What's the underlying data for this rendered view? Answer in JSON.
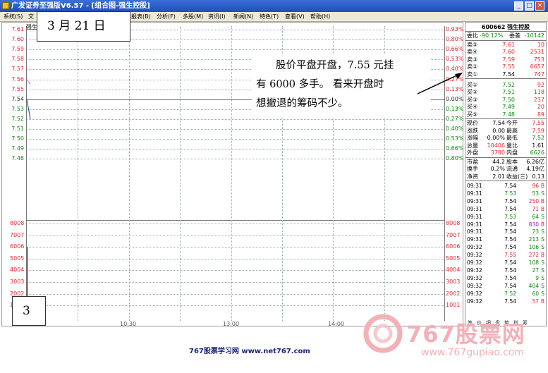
{
  "window": {
    "title": "广发证券至强版V6.57 - [组合图-强生控股]",
    "buttons": [
      "_",
      "□",
      "×"
    ]
  },
  "menu": [
    "系统(S)",
    "文",
    "报表(B)",
    "分析(F)",
    "多股(M)",
    "资讯(I)",
    "新闻(N)",
    "特色(T)",
    "查看(V)",
    "帮助(H)"
  ],
  "chart": {
    "stock_label": "强生",
    "date_label": "3 月 21 日",
    "figure_number": "3",
    "price_ticks_left": [
      "7.61",
      "7.60",
      "7.59",
      "7.58",
      "7.57",
      "7.56",
      "7.55",
      "7.54",
      "7.53",
      "7.52",
      "7.51",
      "7.50",
      "7.49",
      "7.48"
    ],
    "pct_ticks_right": [
      "0.93%",
      "0.80%",
      "0.66%",
      "0.53%",
      "0.40%",
      "0.27%",
      "0.13%",
      "0.00%",
      "0.13%",
      "0.27%",
      "0.40%",
      "0.53%",
      "0.66%",
      "0.80%"
    ],
    "volume_ticks": [
      "8008",
      "7007",
      "6006",
      "5005",
      "4004",
      "3003",
      "2002",
      "1001"
    ],
    "time_ticks": [
      "10:30",
      "13:00",
      "14:00"
    ]
  },
  "chart_data": {
    "type": "line",
    "xlabel": "",
    "ylabel": "",
    "price_range": [
      7.48,
      7.61
    ],
    "prev_close": 7.54,
    "series": [
      {
        "points": [
          [
            0,
            7.56
          ],
          [
            1,
            7.555
          ]
        ],
        "color": "#d070c0"
      },
      {
        "points": [
          [
            0,
            7.54
          ],
          [
            1,
            7.52
          ]
        ],
        "color": "#2030a0"
      }
    ],
    "volume_range": [
      0,
      8008
    ],
    "volume": [
      6000
    ]
  },
  "quote": {
    "title": "600662 强生控股",
    "weibi_label": "委比",
    "weibi_val": "-90.12%",
    "weicha_label": "委差",
    "weicha_val": "-10142",
    "asks": [
      {
        "label": "卖⑤",
        "price": "7.61",
        "vol": "10"
      },
      {
        "label": "卖④",
        "price": "7.60",
        "vol": "2531"
      },
      {
        "label": "卖③",
        "price": "7.59",
        "vol": "753"
      },
      {
        "label": "卖②",
        "price": "7.55",
        "vol": "6657"
      },
      {
        "label": "卖①",
        "price": "7.54",
        "vol": "747"
      }
    ],
    "bids": [
      {
        "label": "买①",
        "price": "7.52",
        "vol": "92"
      },
      {
        "label": "买②",
        "price": "7.51",
        "vol": "118"
      },
      {
        "label": "买③",
        "price": "7.50",
        "vol": "237"
      },
      {
        "label": "买④",
        "price": "7.49",
        "vol": "20"
      },
      {
        "label": "买⑤",
        "price": "7.48",
        "vol": "89"
      }
    ],
    "stats": [
      {
        "a": "现价",
        "b": "7.54",
        "c1": "今开",
        "c": "7.55"
      },
      {
        "a": "涨跌",
        "b": "0.00",
        "c1": "最高",
        "c": "7.59"
      },
      {
        "a": "涨幅",
        "b": "0.00%",
        "c1": "最低",
        "c": "7.52"
      },
      {
        "a": "总量",
        "b": "10406",
        "c1": "量比",
        "c": "1.61"
      },
      {
        "a": "外盘",
        "b": "3780",
        "c1": "内盘",
        "c": "6626"
      }
    ],
    "stats2": [
      {
        "a": "市盈",
        "b": "44.2",
        "c1": "股本",
        "c": "6.26亿"
      },
      {
        "a": "换手",
        "b": "0.2%",
        "c1": "流通",
        "c": "4.19亿"
      },
      {
        "a": "净资",
        "b": "2.01",
        "c1": "收益(三)",
        "c": "0.13"
      }
    ],
    "ticks": [
      {
        "t": "09:31",
        "p": "7.54",
        "v": "96",
        "s": "B"
      },
      {
        "t": "09:31",
        "p": "7.53",
        "v": "53",
        "s": "S"
      },
      {
        "t": "09:31",
        "p": "7.54",
        "v": "250",
        "s": "B"
      },
      {
        "t": "09:31",
        "p": "7.54",
        "v": "71",
        "s": "B"
      },
      {
        "t": "09:31",
        "p": "7.53",
        "v": "64",
        "s": "S"
      },
      {
        "t": "09:31",
        "p": "7.54",
        "v": "830",
        "s": "B"
      },
      {
        "t": "09:31",
        "p": "7.54",
        "v": "73",
        "s": "S"
      },
      {
        "t": "09:31",
        "p": "7.54",
        "v": "213",
        "s": "S"
      },
      {
        "t": "09:32",
        "p": "7.54",
        "v": "106",
        "s": "S"
      },
      {
        "t": "09:32",
        "p": "7.55",
        "v": "272",
        "s": "B"
      },
      {
        "t": "09:32",
        "p": "7.54",
        "v": "108",
        "s": "S"
      },
      {
        "t": "09:32",
        "p": "7.54",
        "v": "27",
        "s": "S"
      },
      {
        "t": "09:32",
        "p": "7.54",
        "v": "9",
        "s": "S"
      },
      {
        "t": "09:32",
        "p": "7.54",
        "v": "404",
        "s": "S"
      },
      {
        "t": "09:32",
        "p": "7.52",
        "v": "60",
        "s": "S"
      },
      {
        "t": "09:32",
        "p": "7.54",
        "v": "57",
        "s": "B"
      }
    ],
    "bottom_tabs": [
      "笔",
      "价",
      "细",
      "盘",
      "势",
      "指",
      "筹"
    ]
  },
  "annotation": {
    "line1": "股价平盘开盘，7.55 元挂",
    "line2": "有 6000 多手。 看来开盘时",
    "line3": "想撤退的筹码不少。"
  },
  "footer": {
    "site_text": "767股票学习网 www.net767.com",
    "logo_text": "767股票网",
    "logo_url": "www.767gupiao.com"
  },
  "colors": {
    "up": "#e8262e",
    "down": "#0a8a0a",
    "title_bar": "#2a5fc8",
    "watermark": "#f3b0b6"
  }
}
